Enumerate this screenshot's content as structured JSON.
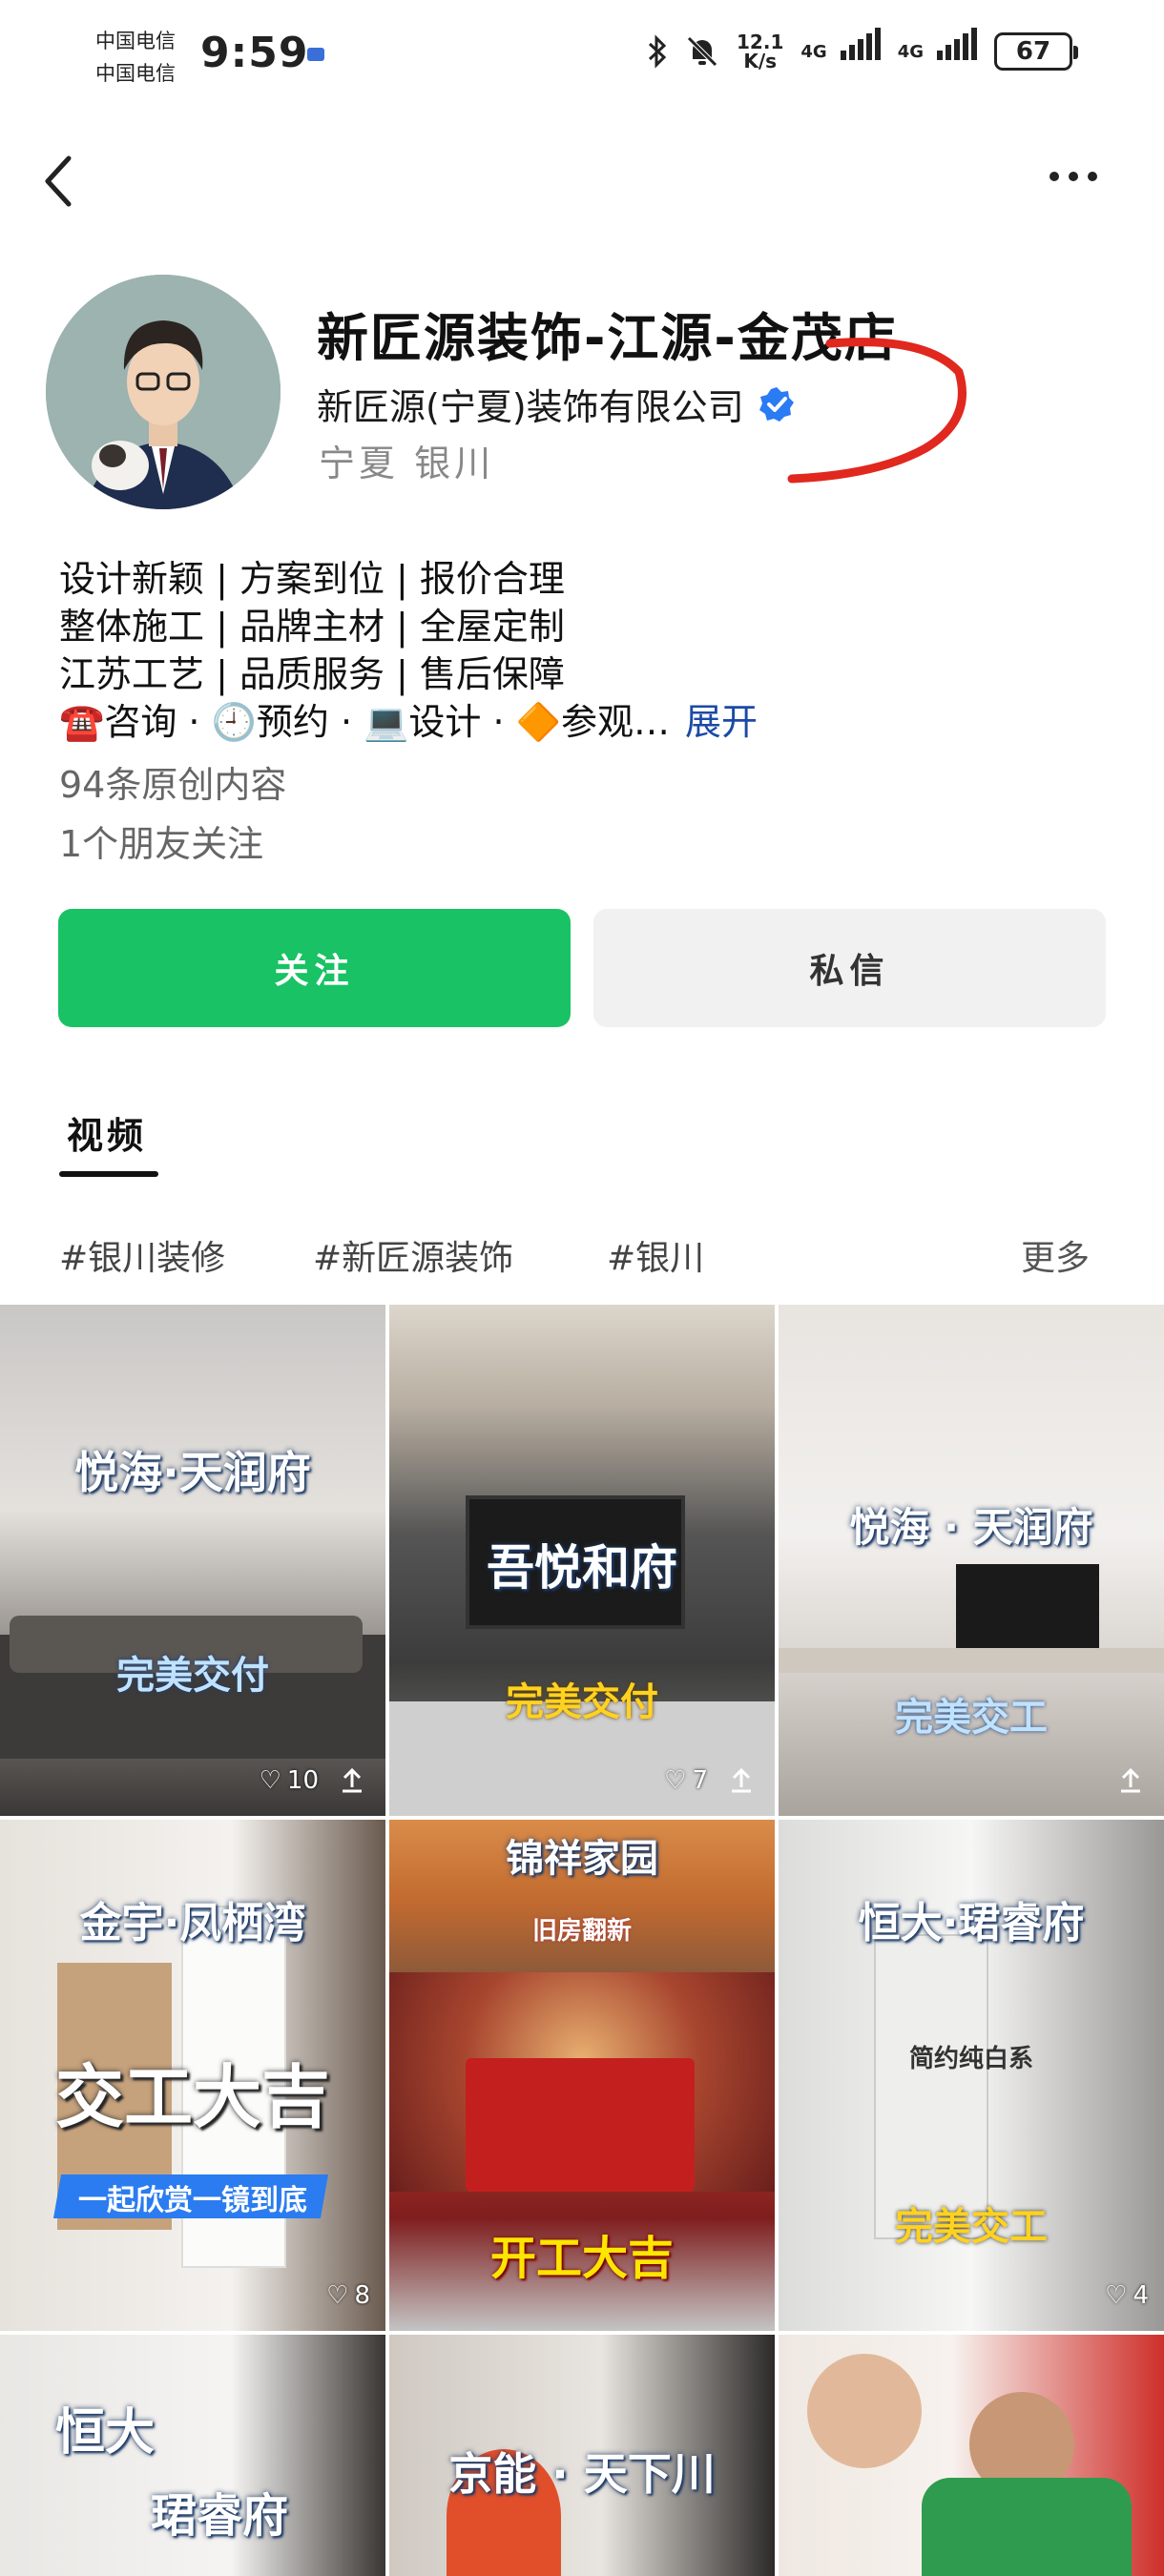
{
  "status_bar": {
    "carrier_1": "中国电信",
    "carrier_2": "中国电信",
    "time": "9:59",
    "net_speed_value": "12.1",
    "net_speed_unit": "K/s",
    "network_1": "4G",
    "network_2": "4G",
    "battery": "67"
  },
  "profile": {
    "name": "新匠源装饰-江源-金茂店",
    "company": "新匠源(宁夏)装饰有限公司",
    "location": "宁夏 银川",
    "bio_lines": [
      "设计新颖 | 方案到位 | 报价合理",
      "整体施工 | 品牌主材 | 全屋定制",
      "江苏工艺 | 品质服务 | 售后保障"
    ],
    "bio_short": "☎️咨询 · 🕘预约 · 💻设计 · 🔶参观…",
    "expand_label": "展开",
    "original_count": "94条原创内容",
    "friends_following": "1个朋友关注"
  },
  "actions": {
    "follow_label": "关注",
    "message_label": "私信"
  },
  "tabs": [
    {
      "label": "视频"
    }
  ],
  "tags": [
    "#银川装修",
    "#新匠源装饰",
    "#银川"
  ],
  "more_label": "更多",
  "videos": [
    {
      "title": "悦海·天润府",
      "subtitle": "完美交付",
      "likes": "10"
    },
    {
      "title": "吾悦和府",
      "subtitle": "完美交付",
      "likes": "7"
    },
    {
      "title": "悦海 · 天润府",
      "subtitle": "完美交工",
      "likes": ""
    },
    {
      "title": "金宇·凤栖湾",
      "subtitle": "交工大吉",
      "caption": "一起欣赏一镜到底",
      "likes": "8"
    },
    {
      "title": "锦祥家园",
      "subtitle": "开工大吉",
      "caption": "旧房翻新",
      "likes": ""
    },
    {
      "title": "恒大·珺睿府",
      "subtitle": "完美交工",
      "caption": "简约纯白系",
      "likes": "4"
    },
    {
      "title": "恒大",
      "subtitle": "珺睿府",
      "likes": ""
    },
    {
      "title": "京能 · 天下川",
      "subtitle": "",
      "likes": ""
    },
    {
      "title": "",
      "subtitle": "",
      "likes": ""
    }
  ],
  "colors": {
    "follow_button": "#19c264",
    "message_button": "#f1f1f1",
    "link": "#1b4aa5",
    "verified_badge": "#2a7bf4",
    "annotation": "#e0281e"
  }
}
